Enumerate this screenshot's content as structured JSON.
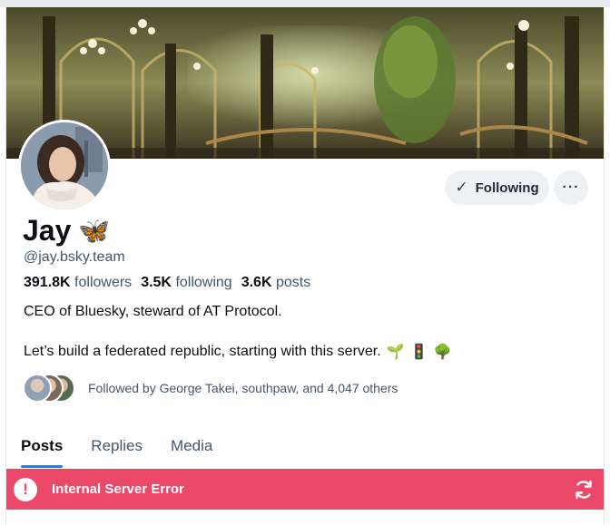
{
  "profile": {
    "display_name": "Jay",
    "name_emoji": "🦋",
    "handle": "@jay.bsky.team",
    "stats": {
      "followers_count": "391.8K",
      "followers_label": "followers",
      "following_count": "3.5K",
      "following_label": "following",
      "posts_count": "3.6K",
      "posts_label": "posts"
    },
    "bio_line1": "CEO of Bluesky, steward of AT Protocol.",
    "bio_line2": "Let’s build a federated republic, starting with this server.",
    "bio_emojis": [
      "🌱",
      "🚦",
      "🌳"
    ],
    "followed_by": "Followed by George Takei, southpaw, and 4,047 others"
  },
  "actions": {
    "following_label": "Following",
    "more_label": "···"
  },
  "tabs": [
    {
      "label": "Posts",
      "active": true
    },
    {
      "label": "Replies",
      "active": false
    },
    {
      "label": "Media",
      "active": false
    }
  ],
  "error": {
    "message": "Internal Server Error",
    "icon_glyph": "!",
    "color": "#ec4868"
  },
  "colors": {
    "accent": "#1083fe",
    "muted_text": "#42576c"
  }
}
